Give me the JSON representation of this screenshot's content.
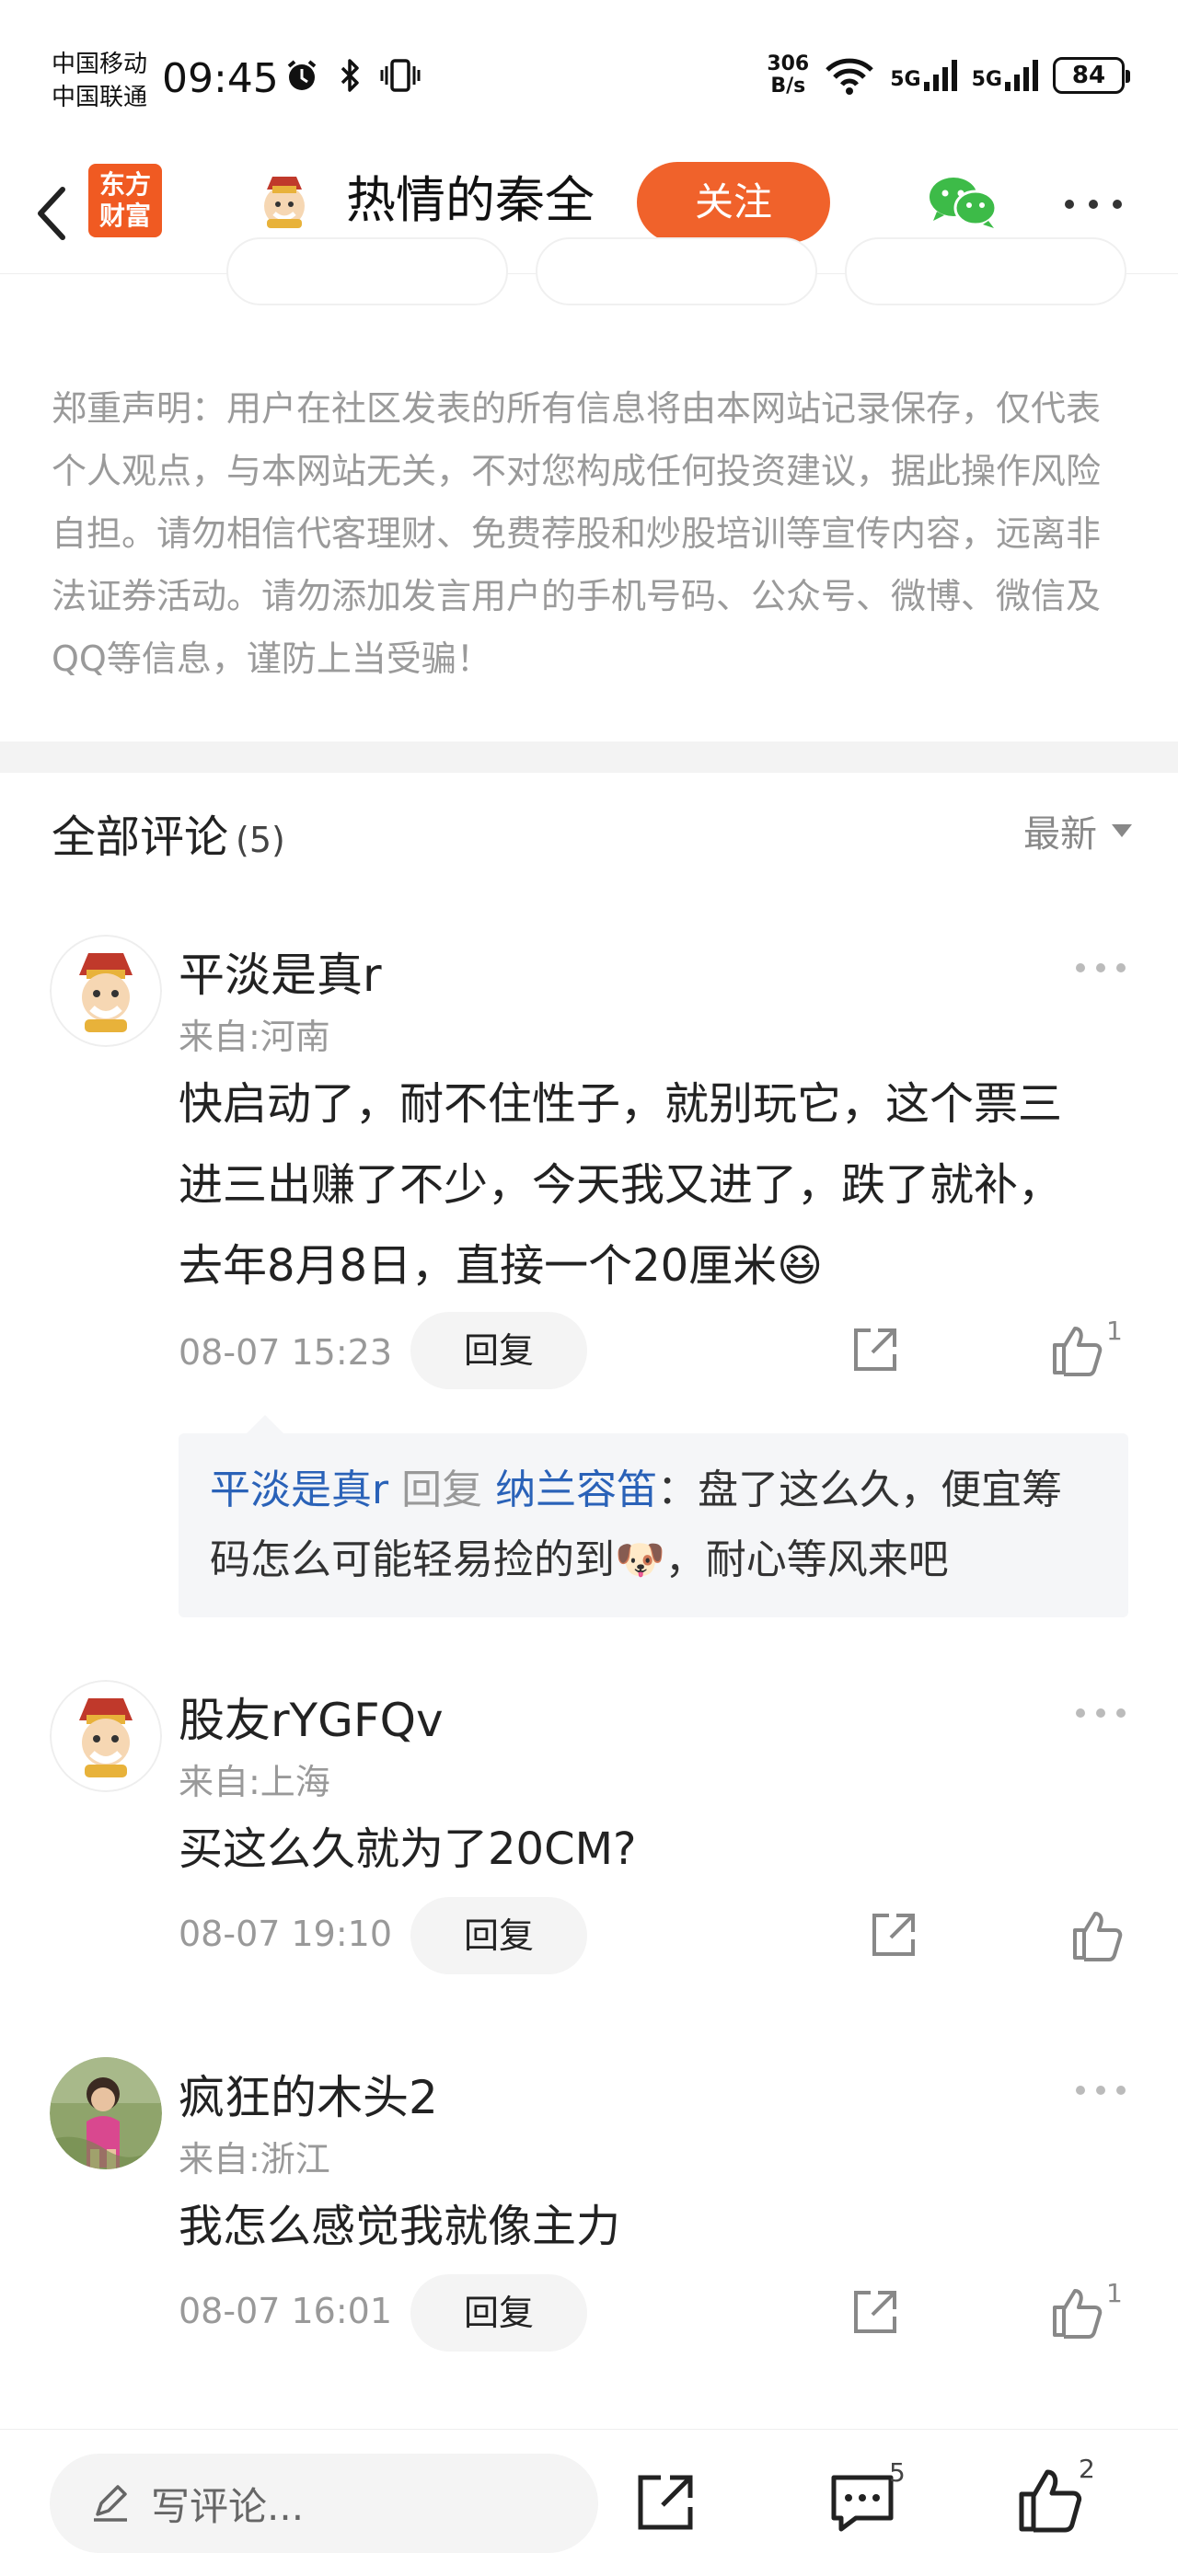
{
  "status_bar": {
    "carrier_1": "中国移动",
    "carrier_2": "中国联通",
    "time": "09:45",
    "net_speed_value": "306",
    "net_speed_unit": "B/s",
    "signal_1_label": "5G",
    "signal_2_label": "5G",
    "battery": "84"
  },
  "nav": {
    "logo_line1": "东方",
    "logo_line2": "财富",
    "title": "热情的秦全",
    "follow_label": "关注",
    "icons": [
      "back-arrow-icon",
      "wechat-icon",
      "more-icon"
    ]
  },
  "disclaimer": "郑重声明：用户在社区发表的所有信息将由本网站记录保存，仅代表个人观点，与本网站无关，不对您构成任何投资建议，据此操作风险自担。请勿相信代客理财、免费荐股和炒股培训等宣传内容，远离非法证券活动。请勿添加发言用户的手机号码、公众号、微博、微信及QQ等信息，谨防上当受骗！",
  "comments_section": {
    "title": "全部评论",
    "count": "(5)",
    "sort_label": "最新"
  },
  "comments": [
    {
      "user": "平淡是真r",
      "from": "来自:河南",
      "text": "快启动了，耐不住性子，就别玩它，这个票三进三出赚了不少，今天我又进了，跌了就补，去年8月8日，直接一个20厘米",
      "emoji": "😆",
      "time": "08-07 15:23",
      "reply_label": "回复",
      "likes": "1",
      "reply": {
        "from_user": "平淡是真r",
        "verb": "回复",
        "to_user": "纳兰容笛",
        "text_before_emoji": "：盘了这么久，便宜筹码怎么可能轻易捡的到",
        "emoji": "🐶",
        "text_after_emoji": "，耐心等风来吧"
      }
    },
    {
      "user": "股友rYGFQv",
      "from": "来自:上海",
      "text": "买这么久就为了20CM?",
      "time": "08-07 19:10",
      "reply_label": "回复",
      "likes": ""
    },
    {
      "user": "疯狂的木头2",
      "from": "来自:浙江",
      "text": "我怎么感觉我就像主力",
      "time": "08-07 16:01",
      "reply_label": "回复",
      "likes": "1"
    }
  ],
  "bottom_bar": {
    "input_placeholder": "写评论...",
    "comment_count": "5",
    "like_count": "2"
  },
  "colors": {
    "accent": "#f0622b",
    "link_blue": "#2a62b8",
    "muted_text": "#999999",
    "wechat_green": "#3dbb48"
  }
}
